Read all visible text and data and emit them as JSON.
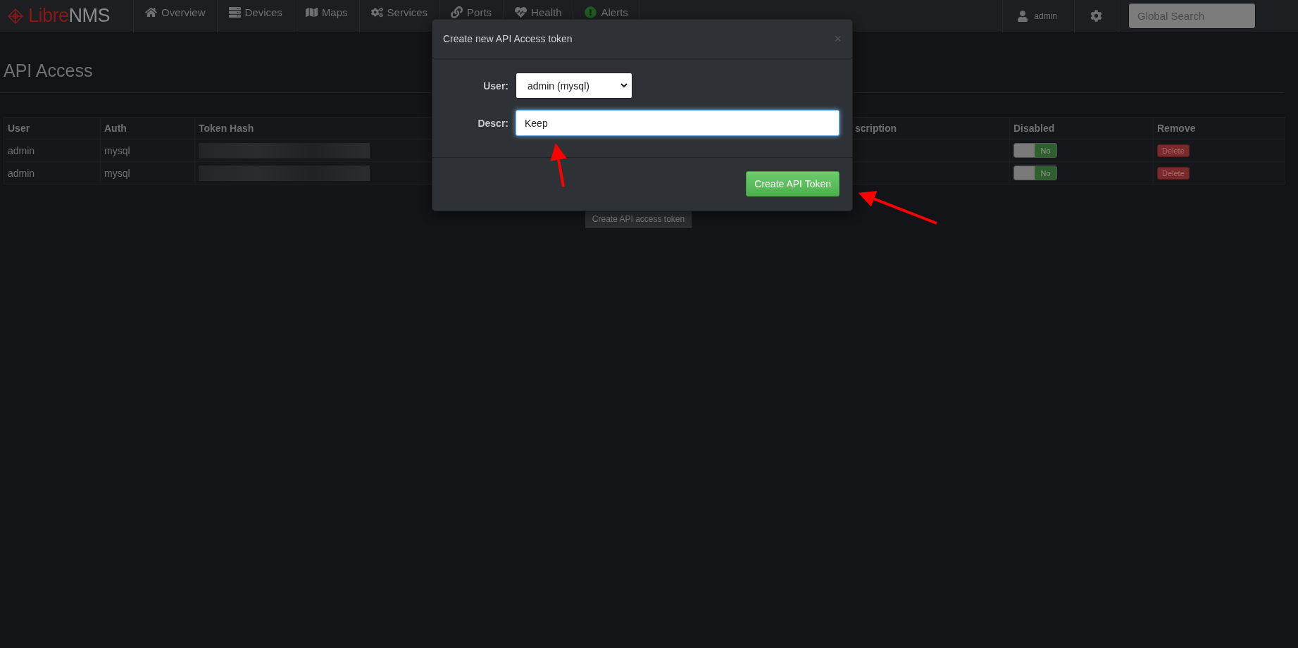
{
  "navbar": {
    "logo": {
      "first": "Libre",
      "second": "NMS"
    },
    "items": [
      {
        "kind": "home",
        "label": "Overview"
      },
      {
        "kind": "server",
        "label": "Devices"
      },
      {
        "kind": "map",
        "label": "Maps"
      },
      {
        "kind": "cogs",
        "label": "Services"
      },
      {
        "kind": "link",
        "label": "Ports"
      },
      {
        "kind": "heart",
        "label": "Health"
      },
      {
        "kind": "alert",
        "label": "Alerts"
      }
    ],
    "user": "admin",
    "search": {
      "placeholder": "Global Search"
    }
  },
  "page": {
    "title": "API Access",
    "table": {
      "columns": [
        "User",
        "Auth",
        "Token Hash",
        "scription",
        "Disabled",
        "Remove"
      ],
      "rows": [
        {
          "user": "admin",
          "auth": "mysql",
          "toggle": "No",
          "disabled": false,
          "remove": "Delete"
        },
        {
          "user": "admin",
          "auth": "mysql",
          "toggle": "No",
          "disabled": false,
          "remove": "Delete"
        }
      ]
    },
    "create_button": "Create API access token"
  },
  "modal": {
    "title": "Create new API Access token",
    "close": "×",
    "user_label": "User:",
    "user_value": "admin (mysql)",
    "descr_label": "Descr:",
    "descr_value": "Keep",
    "submit": "Create API Token"
  }
}
